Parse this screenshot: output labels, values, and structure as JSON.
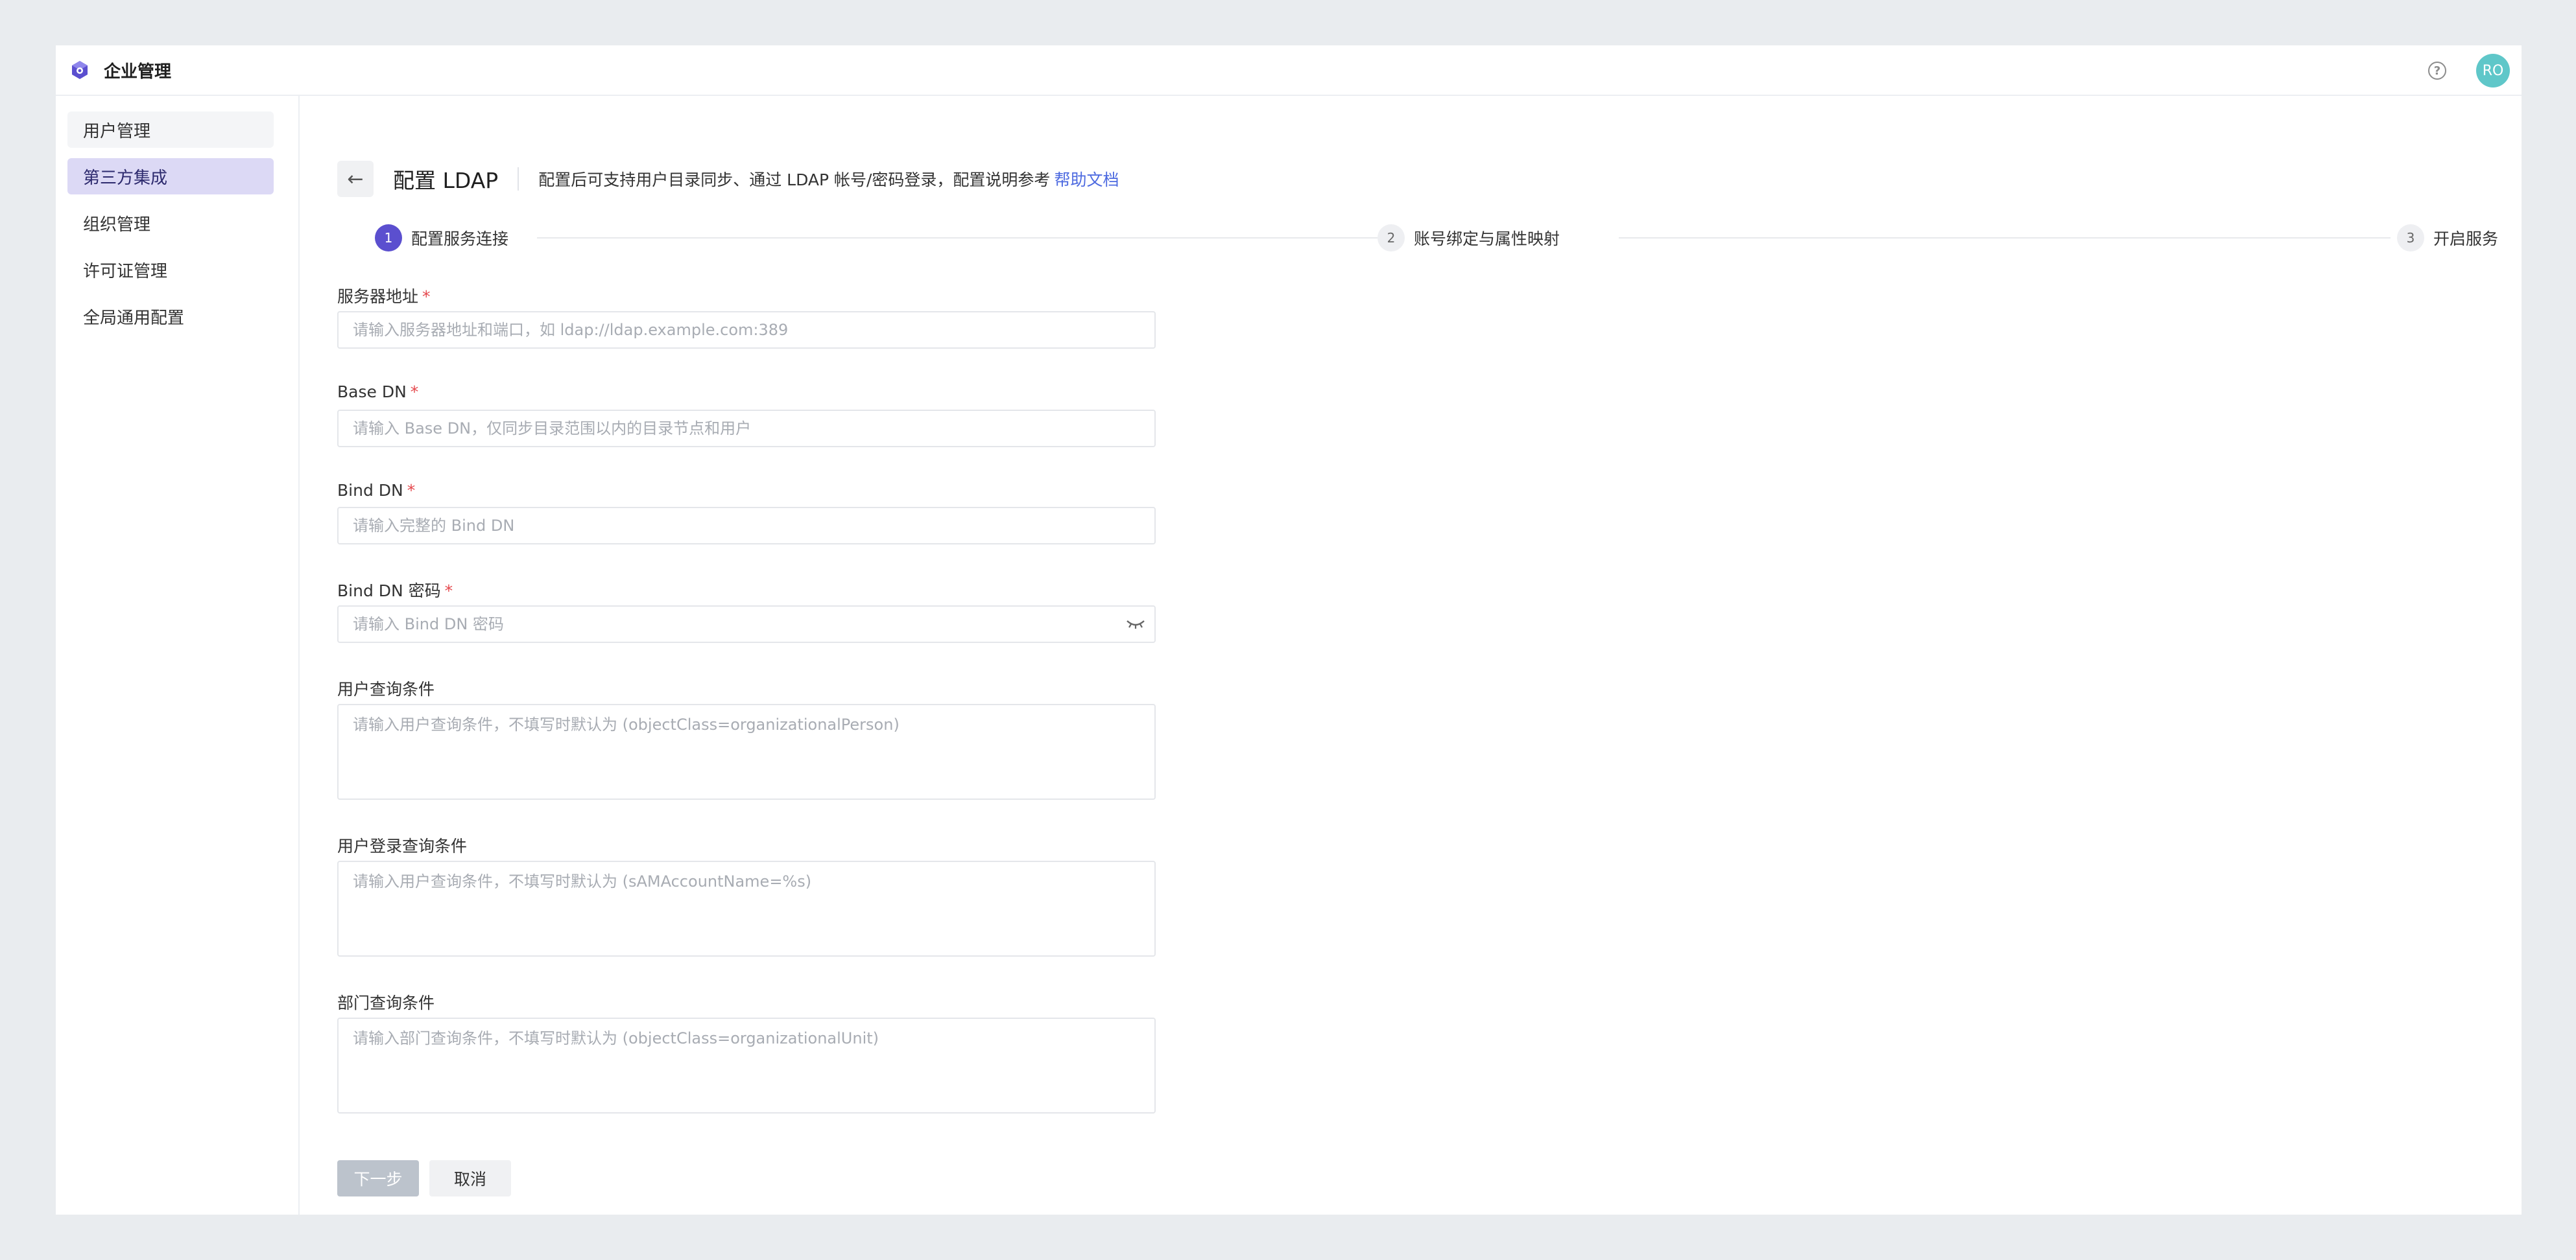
{
  "app": {
    "title": "企业管理",
    "help_glyph": "?",
    "avatar_initials": "RO",
    "avatar_color": "#5fc7c9",
    "accent_color": "#5b4fcf"
  },
  "sidebar": {
    "items": [
      {
        "label": "用户管理",
        "state": "hover"
      },
      {
        "label": "第三方集成",
        "state": "active"
      },
      {
        "label": "组织管理",
        "state": "normal"
      },
      {
        "label": "许可证管理",
        "state": "normal"
      },
      {
        "label": "全局通用配置",
        "state": "normal"
      }
    ]
  },
  "page": {
    "back_icon": "arrow-left-icon",
    "back_glyph": "←",
    "title": "配置 LDAP",
    "description": "配置后可支持用户目录同步、通过 LDAP 帐号/密码登录，配置说明参考",
    "help_link": "帮助文档"
  },
  "steps": [
    {
      "num": "1",
      "label": "配置服务连接",
      "active": true
    },
    {
      "num": "2",
      "label": "账号绑定与属性映射",
      "active": false
    },
    {
      "num": "3",
      "label": "开启服务",
      "active": false
    }
  ],
  "form": {
    "server": {
      "label": "服务器地址",
      "required": "*",
      "value": "",
      "placeholder": "请输入服务器地址和端口，如 ldap://ldap.example.com:389"
    },
    "base_dn": {
      "label": "Base DN",
      "required": "*",
      "value": "",
      "placeholder": "请输入 Base DN，仅同步目录范围以内的目录节点和用户"
    },
    "bind_dn": {
      "label": "Bind DN",
      "required": "*",
      "value": "",
      "placeholder": "请输入完整的 Bind DN"
    },
    "bind_pwd": {
      "label": "Bind DN 密码",
      "required": "*",
      "value": "",
      "placeholder": "请输入 Bind DN 密码",
      "toggle_icon": "eye-closed-icon"
    },
    "user_query": {
      "label": "用户查询条件",
      "value": "",
      "placeholder": "请输入用户查询条件，不填写时默认为 (objectClass=organizationalPerson)"
    },
    "login_query": {
      "label": "用户登录查询条件",
      "value": "",
      "placeholder": "请输入用户查询条件，不填写时默认为 (sAMAccountName=%s)"
    },
    "dept_query": {
      "label": "部门查询条件",
      "value": "",
      "placeholder": "请输入部门查询条件，不填写时默认为 (objectClass=organizationalUnit)"
    }
  },
  "buttons": {
    "next": "下一步",
    "next_disabled": true,
    "cancel": "取消"
  }
}
